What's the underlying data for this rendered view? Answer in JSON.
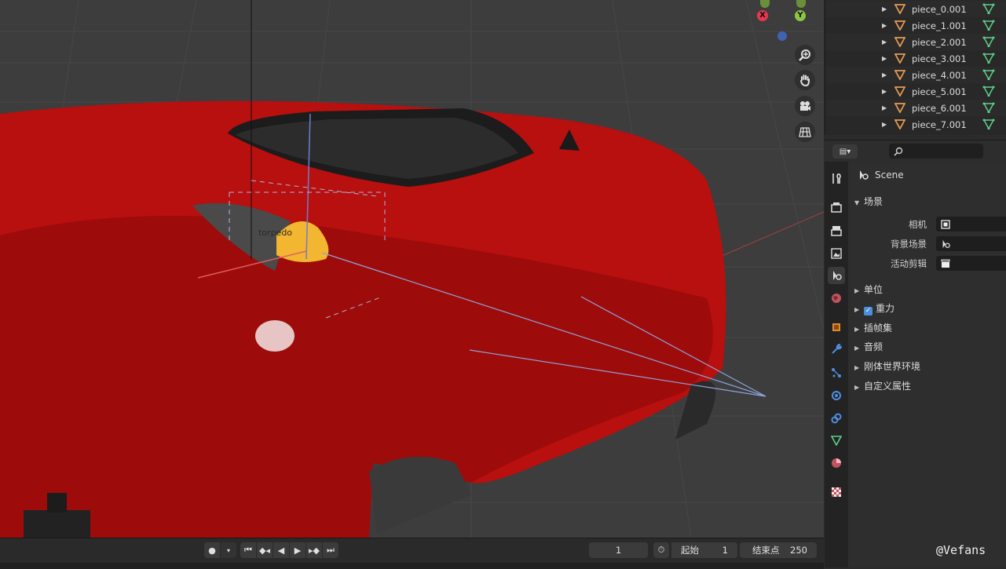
{
  "viewport": {
    "object_label": "torpedo",
    "gizmo": {
      "x_label": "X",
      "y_label": "Y",
      "colors": {
        "x": "#e8384f",
        "y": "#8cc63f",
        "z": "#3f7ad6"
      }
    },
    "nav_buttons": [
      "zoom-icon",
      "hand-pan-icon",
      "camera-icon",
      "grid-view-icon"
    ]
  },
  "outliner": {
    "items": [
      {
        "name": "piece_0.001"
      },
      {
        "name": "piece_1.001"
      },
      {
        "name": "piece_2.001"
      },
      {
        "name": "piece_3.001"
      },
      {
        "name": "piece_4.001"
      },
      {
        "name": "piece_5.001"
      },
      {
        "name": "piece_6.001"
      },
      {
        "name": "piece_7.001"
      }
    ]
  },
  "properties": {
    "tabs": [
      "tool-icon",
      "render-icon",
      "output-icon",
      "view-layer-icon",
      "scene-icon",
      "world-icon",
      "object-icon",
      "modifier-icon",
      "particles-icon",
      "physics-icon",
      "constraints-icon",
      "data-icon",
      "material-icon",
      "texture-icon"
    ],
    "context_title": "Scene",
    "panel_title": "场景",
    "fields": [
      {
        "label": "相机"
      },
      {
        "label": "背景场景"
      },
      {
        "label": "活动剪辑"
      }
    ],
    "collapsed_sections": [
      {
        "label": "单位"
      },
      {
        "label": "重力",
        "checked": true
      },
      {
        "label": "插帧集"
      },
      {
        "label": "音频"
      },
      {
        "label": "刚体世界环境"
      },
      {
        "label": "自定义属性"
      }
    ]
  },
  "timeline": {
    "current_frame": "1",
    "start_label": "起始",
    "start_value": "1",
    "end_label": "结束点",
    "end_value": "250"
  },
  "watermark": "@Vefans"
}
